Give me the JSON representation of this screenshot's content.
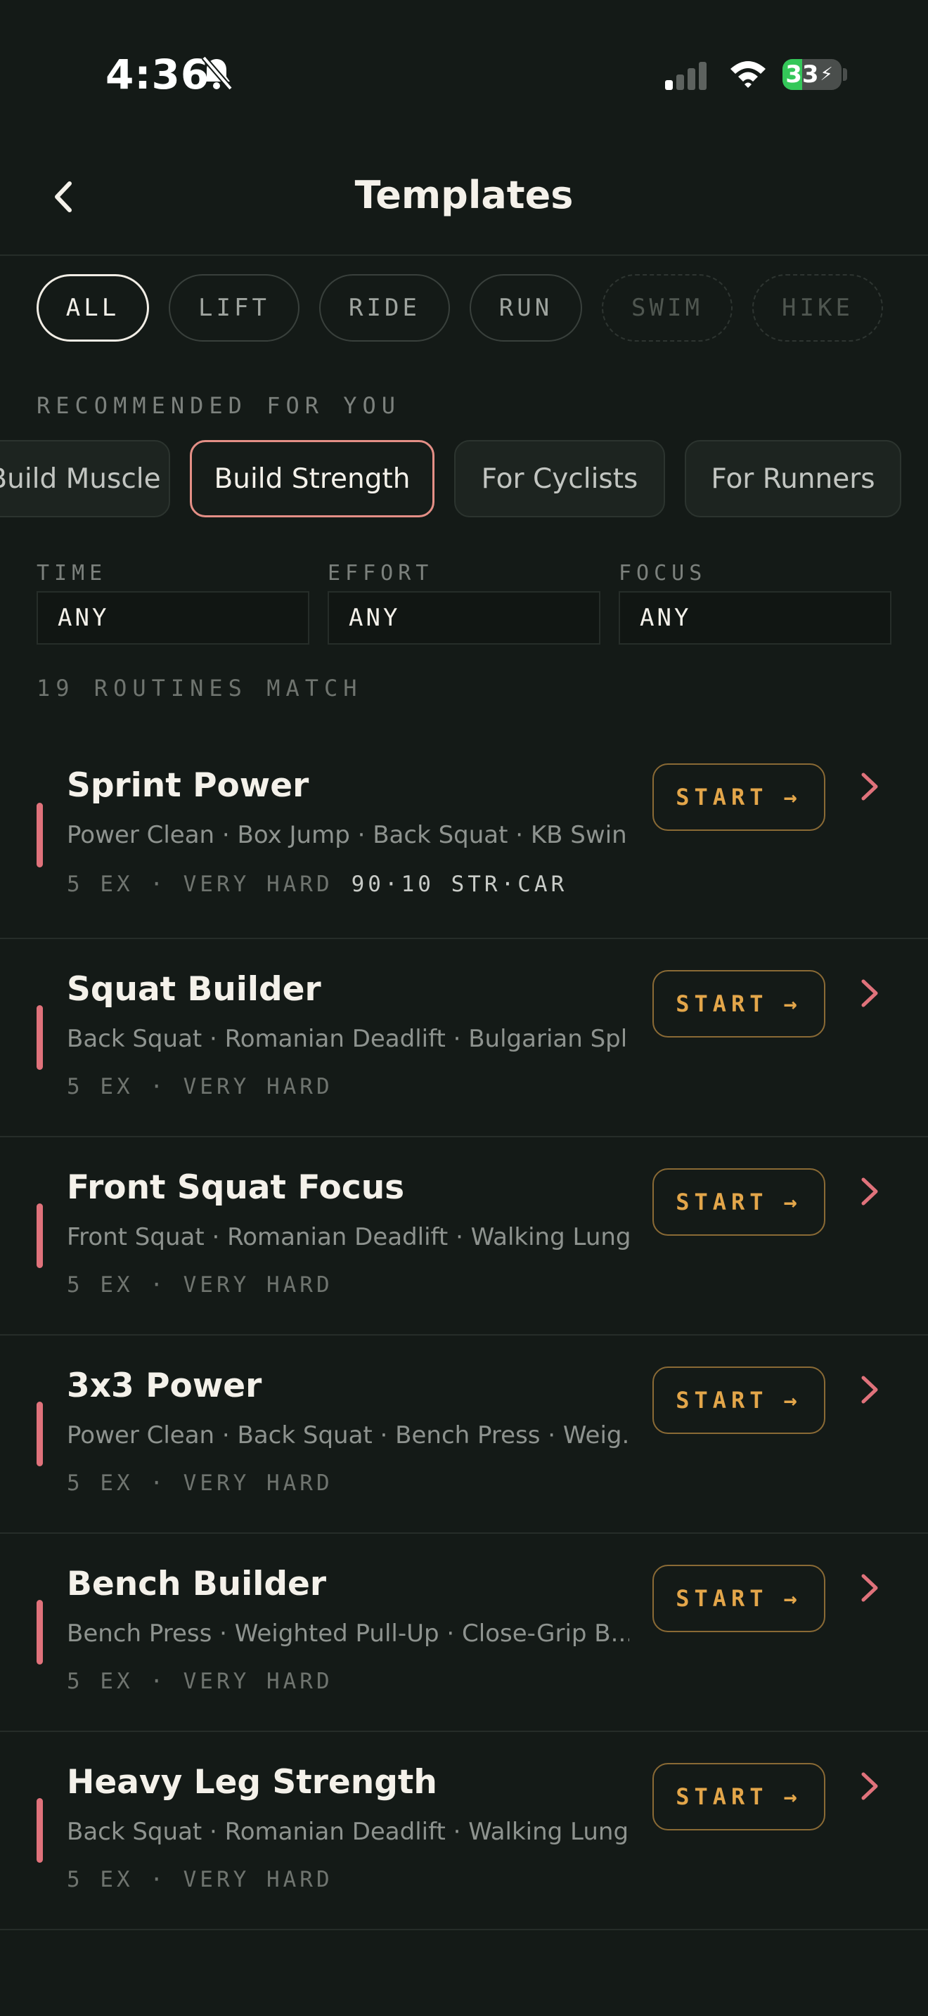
{
  "status_bar": {
    "time": "4:36",
    "battery": "33"
  },
  "header": {
    "title": "Templates"
  },
  "filters": {
    "chips": [
      {
        "label": "ALL",
        "state": "active"
      },
      {
        "label": "LIFT",
        "state": "normal"
      },
      {
        "label": "RIDE",
        "state": "normal"
      },
      {
        "label": "RUN",
        "state": "normal"
      },
      {
        "label": "SWIM",
        "state": "disabled"
      },
      {
        "label": "HIKE",
        "state": "disabled"
      }
    ]
  },
  "recommended": {
    "label": "RECOMMENDED FOR YOU",
    "goals": [
      "Build Muscle",
      "Build Strength",
      "For Cyclists",
      "For Runners"
    ],
    "selected": "Build Strength"
  },
  "selects": {
    "time": {
      "label": "TIME",
      "value": "ANY"
    },
    "effort": {
      "label": "EFFORT",
      "value": "ANY"
    },
    "focus": {
      "label": "FOCUS",
      "value": "ANY"
    }
  },
  "results": {
    "count_label": "19 ROUTINES MATCH"
  },
  "routines": [
    {
      "title": "Sprint Power",
      "exercises": "Power Clean · Box Jump · Back Squat · KB Swin...",
      "meta": "5 EX · VERY HARD",
      "extra": "90·10 STR·CAR",
      "start_label": "START"
    },
    {
      "title": "Squat Builder",
      "exercises": "Back Squat · Romanian Deadlift · Bulgarian Spli...",
      "meta": "5 EX · VERY HARD",
      "start_label": "START"
    },
    {
      "title": "Front Squat Focus",
      "exercises": "Front Squat · Romanian Deadlift · Walking Lung...",
      "meta": "5 EX · VERY HARD",
      "start_label": "START"
    },
    {
      "title": "3x3 Power",
      "exercises": "Power Clean · Back Squat · Bench Press · Weig...",
      "meta": "5 EX · VERY HARD",
      "start_label": "START"
    },
    {
      "title": "Bench Builder",
      "exercises": "Bench Press · Weighted Pull-Up · Close-Grip B...",
      "meta": "5 EX · VERY HARD",
      "start_label": "START"
    },
    {
      "title": "Heavy Leg Strength",
      "exercises": "Back Squat · Romanian Deadlift · Walking Lung...",
      "meta": "5 EX · VERY HARD",
      "start_label": "START"
    }
  ],
  "colors": {
    "background": "#141a17",
    "accent_start": "#e3a64a",
    "accent_intensity": "#e0727b",
    "selected_goal_border": "#e48f86"
  },
  "icons": {
    "back": "chevron-left-icon",
    "routine_open": "chevron-right-icon",
    "start_arrow": "arrow-right-icon",
    "status": [
      "bell-slash-icon",
      "signal-icon",
      "wifi-icon",
      "battery-icon"
    ]
  }
}
